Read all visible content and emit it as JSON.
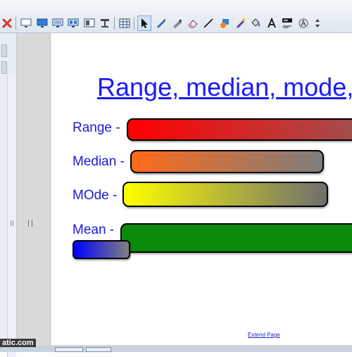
{
  "toolbar": {
    "tools": [
      {
        "icon": "close-icon",
        "color": "#d9342b"
      },
      {
        "icon": "blank-screen-icon"
      },
      {
        "icon": "screen-shade-icon"
      },
      {
        "icon": "monitor-icon"
      },
      {
        "icon": "dual-screen-icon"
      },
      {
        "icon": "slide-window-icon"
      },
      {
        "icon": "document-camera-icon"
      },
      {
        "icon": "table-icon"
      },
      {
        "icon": "select-cursor-icon",
        "active": true
      },
      {
        "icon": "pen-icon"
      },
      {
        "icon": "highlighter-icon"
      },
      {
        "icon": "eraser-icon"
      },
      {
        "icon": "line-icon"
      },
      {
        "icon": "shapes-icon"
      },
      {
        "icon": "magic-pen-icon"
      },
      {
        "icon": "fill-bucket-icon"
      },
      {
        "icon": "text-icon"
      },
      {
        "icon": "handwriting-recognition-icon"
      },
      {
        "icon": "properties-icon"
      },
      {
        "icon": "more-arrows-icon"
      }
    ]
  },
  "page": {
    "title": "Range, median, mode,",
    "terms": [
      {
        "label": "Range -",
        "gradient": [
          "#ff0000",
          "#a05050"
        ]
      },
      {
        "label": "Median -",
        "gradient": [
          "#ff6a1a",
          "#7d7d7d"
        ]
      },
      {
        "label": "MOde -",
        "gradient": [
          "#ffff00",
          "#6e6e6e"
        ]
      },
      {
        "label": "Mean -",
        "gradient": [
          "#0a8a0a",
          "#0a8a0a"
        ]
      }
    ],
    "extra_swatch_gradient": [
      "#0000ff",
      "#808080"
    ],
    "extend_link": "Extend Page"
  },
  "watermark": "atic.com"
}
